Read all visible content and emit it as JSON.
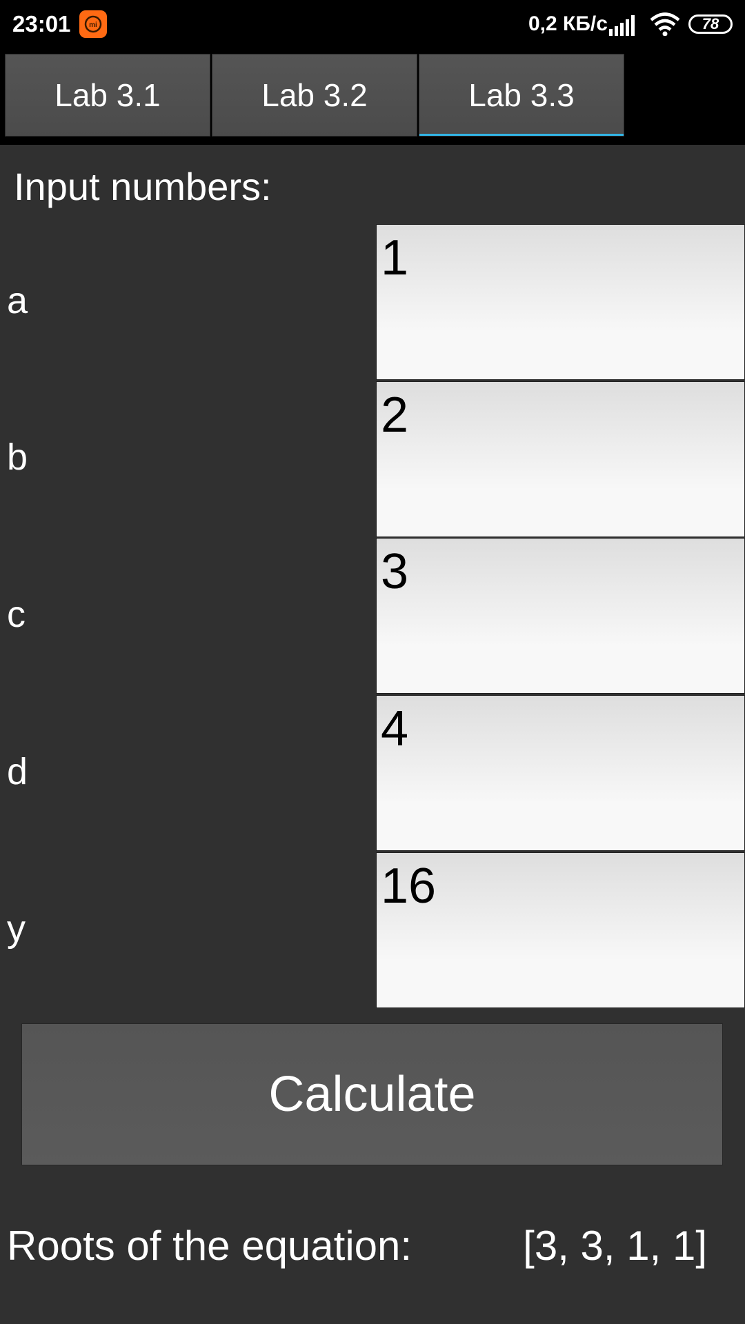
{
  "status_bar": {
    "time": "23:01",
    "net_speed": "0,2 КБ/с",
    "battery": "78",
    "icons": [
      "mi-icon",
      "signal-icon",
      "wifi-icon",
      "battery-icon"
    ]
  },
  "tabs": [
    {
      "label": "Lab 3.1",
      "selected": false
    },
    {
      "label": "Lab 3.2",
      "selected": false
    },
    {
      "label": "Lab 3.3",
      "selected": true
    }
  ],
  "form": {
    "header": "Input numbers:",
    "fields": [
      {
        "label": "a",
        "value": "1"
      },
      {
        "label": "b",
        "value": "2"
      },
      {
        "label": "c",
        "value": "3"
      },
      {
        "label": "d",
        "value": "4"
      },
      {
        "label": "y",
        "value": "16"
      }
    ],
    "calculate_label": "Calculate"
  },
  "result": {
    "label": "Roots of the equation:",
    "value": "[3, 3, 1, 1]"
  },
  "colors": {
    "background": "#303030",
    "tab_indicator": "#33b5e5",
    "mi_brand": "#ff6a13"
  }
}
